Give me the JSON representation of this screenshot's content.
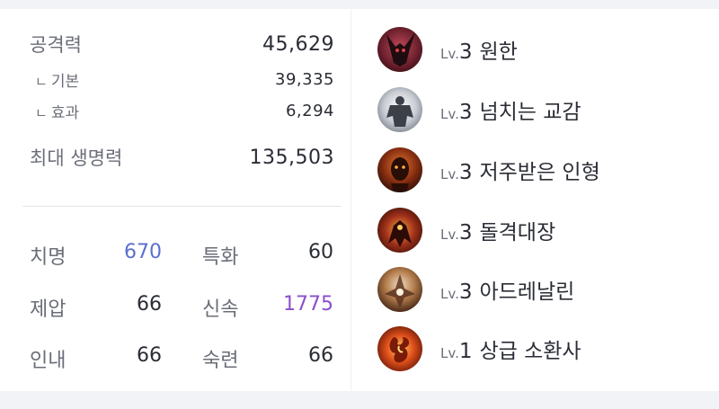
{
  "stats": {
    "attack": {
      "label": "공격력",
      "value": "45,629"
    },
    "attack_base": {
      "corner": "ㄴ",
      "label": "기본",
      "value": "39,335"
    },
    "attack_effect": {
      "corner": "ㄴ",
      "label": "효과",
      "value": "6,294"
    },
    "max_hp": {
      "label": "최대 생명력",
      "value": "135,503"
    }
  },
  "combat_stats": [
    {
      "label": "치명",
      "value": "670",
      "accent": "#5b6fd0"
    },
    {
      "label": "특화",
      "value": "60"
    },
    {
      "label": "제압",
      "value": "66"
    },
    {
      "label": "신속",
      "value": "1775",
      "accent": "#8a4fcf"
    },
    {
      "label": "인내",
      "value": "66"
    },
    {
      "label": "숙련",
      "value": "66"
    }
  ],
  "engravings": [
    {
      "prefix": "Lv.",
      "level": "3",
      "name": "원한",
      "icon": "demon-horns-icon"
    },
    {
      "prefix": "Lv.",
      "level": "3",
      "name": "넘치는 교감",
      "icon": "spirit-figure-icon"
    },
    {
      "prefix": "Lv.",
      "level": "3",
      "name": "저주받은 인형",
      "icon": "cursed-doll-icon"
    },
    {
      "prefix": "Lv.",
      "level": "3",
      "name": "돌격대장",
      "icon": "charging-warrior-icon"
    },
    {
      "prefix": "Lv.",
      "level": "3",
      "name": "아드레날린",
      "icon": "adrenaline-icon"
    },
    {
      "prefix": "Lv.",
      "level": "1",
      "name": "상급 소환사",
      "icon": "summoner-flame-icon"
    }
  ]
}
